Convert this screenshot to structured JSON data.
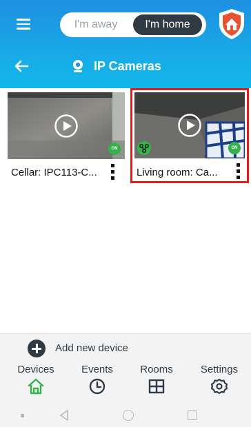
{
  "header": {
    "mode_away_label": "I'm away",
    "mode_home_label": "I'm home",
    "active_mode": "I'm home",
    "title": "IP Cameras",
    "accent_color": "#1e9be3"
  },
  "cameras": [
    {
      "label": "Cellar: IPC113-C...",
      "status": "ON",
      "selected": false
    },
    {
      "label": "Living room: Ca...",
      "status": "ON",
      "selected": true,
      "selection_color": "#e21b1b"
    }
  ],
  "add_device": {
    "label": "Add new device"
  },
  "bottom_nav": {
    "devices": {
      "label": "Devices",
      "icon": "home-icon",
      "active": true
    },
    "events": {
      "label": "Events",
      "icon": "clock-icon"
    },
    "rooms": {
      "label": "Rooms",
      "icon": "grid-icon"
    },
    "settings": {
      "label": "Settings",
      "icon": "gear-icon"
    }
  },
  "colors": {
    "status_on": "#35b24a",
    "active_nav": "#35b24a",
    "nav_text": "#2e3b44"
  }
}
